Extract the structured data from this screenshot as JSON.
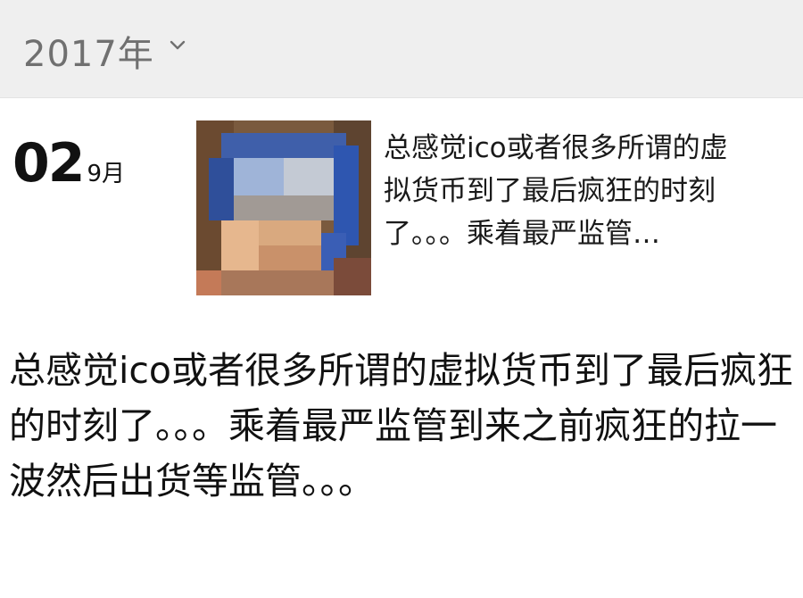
{
  "header": {
    "year": "2017年",
    "dropdown_icon": "chevron-down-icon"
  },
  "post": {
    "day": "02",
    "month": "9月",
    "thumbnail_icon": "pixelated-photo",
    "summary_lines": [
      "总感觉ico或者很多所谓的虚",
      "拟货币到了最后疯狂的时刻",
      "了。。。乘着最严监管…"
    ],
    "full_text": "总感觉ico或者很多所谓的虚拟货币到了最后疯狂的时刻了。。。乘着最严监管到来之前疯狂的拉一波然后出货等监管。。。"
  },
  "colors": {
    "header_bg": "#efefef",
    "header_text": "#707070",
    "text": "#111111"
  }
}
